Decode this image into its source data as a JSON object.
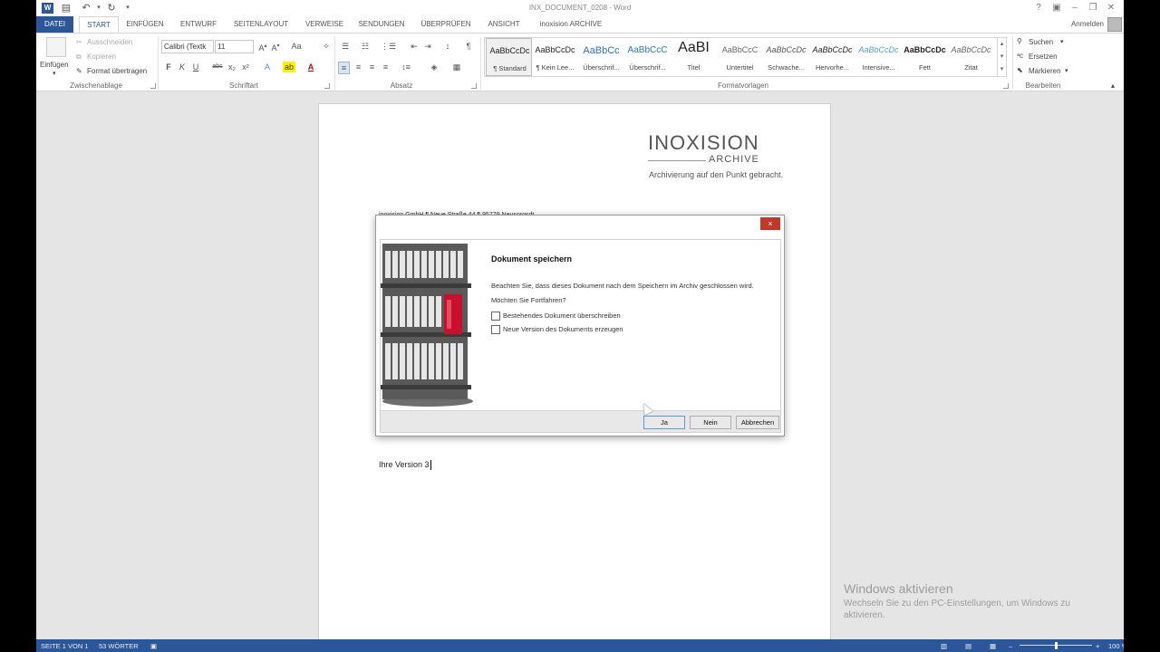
{
  "window": {
    "title": "INX_DOCUMENT_0208 - Word",
    "sign_in": "Anmelden"
  },
  "tabs": [
    {
      "label": "DATEI"
    },
    {
      "label": "START"
    },
    {
      "label": "EINFÜGEN"
    },
    {
      "label": "ENTWURF"
    },
    {
      "label": "SEITENLAYOUT"
    },
    {
      "label": "VERWEISE"
    },
    {
      "label": "SENDUNGEN"
    },
    {
      "label": "ÜBERPRÜFEN"
    },
    {
      "label": "ANSICHT"
    },
    {
      "label": "inoxision ARCHIVE"
    }
  ],
  "ribbon": {
    "clipboard": {
      "paste": "Einfügen",
      "cut": "Ausschneiden",
      "copy": "Kopieren",
      "format_painter": "Format übertragen",
      "group": "Zwischenablage"
    },
    "font": {
      "name": "Calibri (Textk",
      "size": "11",
      "bold": "F",
      "italic": "K",
      "underline": "U",
      "strike": "abc",
      "subscript": "x₂",
      "superscript": "x²",
      "case": "Aa",
      "group": "Schriftart"
    },
    "paragraph": {
      "group": "Absatz",
      "pilcrow": "¶"
    },
    "styles": {
      "group": "Formatvorlagen",
      "items": [
        {
          "preview": "AaBbCcDc",
          "name": "¶ Standard"
        },
        {
          "preview": "AaBbCcDc",
          "name": "¶ Kein Lee..."
        },
        {
          "preview": "AaBbCc",
          "name": "Überschrif..."
        },
        {
          "preview": "AaBbCcC",
          "name": "Überschrif..."
        },
        {
          "preview": "AaBI",
          "name": "Titel"
        },
        {
          "preview": "AaBbCcC",
          "name": "Untertitel"
        },
        {
          "preview": "AaBbCcDc",
          "name": "Schwache..."
        },
        {
          "preview": "AaBbCcDc",
          "name": "Hervorhe..."
        },
        {
          "preview": "AaBbCcDc",
          "name": "Intensive..."
        },
        {
          "preview": "AaBbCcDc",
          "name": "Fett"
        },
        {
          "preview": "AaBbCcDc",
          "name": "Zitat"
        }
      ]
    },
    "editing": {
      "find": "Suchen",
      "replace": "Ersetzen",
      "select": "Markieren",
      "group": "Bearbeiten"
    }
  },
  "document": {
    "logo_main": "INOXISION",
    "logo_sub": "ARCHIVE",
    "logo_tagline": "Archivierung auf den Punkt gebracht.",
    "hidden_line": "inoxision GmbH ¶ Neue Straße 44 ¶ 95779 Neusorgsdt",
    "body_text": "Ihre Version 3"
  },
  "dialog": {
    "heading": "Dokument speichern",
    "message_line1": "Beachten Sie, dass dieses Dokument nach dem Speichern im Archiv geschlossen wird.",
    "message_line2": "Möchten Sie Fortfahren?",
    "option_overwrite": "Bestehendes Dokument überschreiben",
    "option_new_version": "Neue Version des Dokuments erzeugen",
    "btn_yes": "Ja",
    "btn_no": "Nein",
    "btn_cancel": "Abbrechen",
    "close": "×"
  },
  "watermark": {
    "title": "Windows aktivieren",
    "text": "Wechseln Sie zu den PC-Einstellungen, um Windows zu aktivieren."
  },
  "status": {
    "page": "SEITE 1 VON 1",
    "words": "53 WÖRTER",
    "zoom": "100 %",
    "zoom_level": 0.5
  },
  "colors": {
    "accent": "#2b579a",
    "brand_red": "#b31b34",
    "close_red": "#c0392b"
  }
}
